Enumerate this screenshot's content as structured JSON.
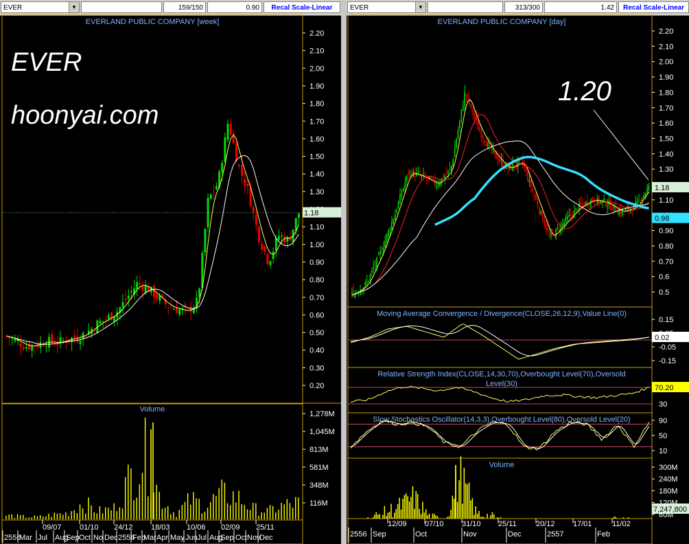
{
  "left": {
    "symbol": "EVER",
    "bar_count": "159/150",
    "last_price": "0.90",
    "recal_label": "Recal Scale-Linear",
    "title": "EVERLAND PUBLIC COMPANY [week]",
    "watermark_symbol": "EVER",
    "watermark_site": "hoonyai.com",
    "price_axis": [
      "2.20",
      "2.10",
      "2.00",
      "1.90",
      "1.80",
      "1.70",
      "1.60",
      "1.50",
      "1.40",
      "1.30",
      "1.20",
      "1.10",
      "1.00",
      "0.90",
      "0.80",
      "0.70",
      "0.60",
      "0.50",
      "0.40",
      "0.30",
      "0.20"
    ],
    "price_marker": "1.18",
    "volume_title": "Volume",
    "volume_axis": [
      "1,278M",
      "1,045M",
      "813M",
      "581M",
      "348M",
      "116M"
    ],
    "date_ticks": [
      "09/07",
      "01/10",
      "24/12",
      "18/03",
      "10/06",
      "02/09",
      "25/11"
    ],
    "month_ticks": [
      "2556",
      "Mar",
      "Jul",
      "Aug",
      "Sep",
      "Oct",
      "No",
      "Dec",
      "2556",
      "Feb",
      "Mar",
      "Apr",
      "May",
      "Jun",
      "Jul",
      "Aug",
      "Sep",
      "Oct",
      "Nov",
      "Dec"
    ]
  },
  "right": {
    "symbol": "EVER",
    "bar_count": "313/300",
    "last_price": "1.42",
    "recal_label": "Recal Scale-Linear",
    "title": "EVERLAND PUBLIC COMPANY [day]",
    "annotation": "1.20",
    "price_axis": [
      "2.20",
      "2.10",
      "2.00",
      "1.90",
      "1.80",
      "1.70",
      "1.60",
      "1.50",
      "1.40",
      "1.30",
      "1.20",
      "1.10",
      "1.00",
      "0.90",
      "0.80",
      "0.70",
      "0.6",
      "0.5"
    ],
    "price_marker_1": "1.18",
    "price_marker_2": "0.98",
    "macd_title": "Moving Average Convergence / Divergence(CLOSE,26,12,9),Value Line(0)",
    "macd_axis": [
      "0.15",
      "0.05",
      "-0.05",
      "-0.15"
    ],
    "macd_marker": "0.02",
    "rsi_title_1": "Relative Strength Index(CLOSE,14,30,70),Overbought Level(70),Oversold",
    "rsi_title_2": "Level(30)",
    "rsi_axis": [
      "70",
      "30"
    ],
    "rsi_marker": "70.20",
    "stoch_title": "Slow Stochastics Oscillator(14,3,3),Overbought Level(80),Oversold Level(20)",
    "stoch_axis": [
      "90",
      "50",
      "10"
    ],
    "volume_title": "Volume",
    "volume_axis": [
      "300M",
      "240M",
      "180M",
      "120M",
      "60M"
    ],
    "volume_marker": "7,247,800",
    "date_ticks": [
      "12/09",
      "07/10",
      "31/10",
      "25/11",
      "20/12",
      "17/01",
      "11/02"
    ],
    "month_ticks": [
      "2556",
      "Sep",
      "Oct",
      "Nov",
      "Dec",
      "2557",
      "Feb"
    ]
  },
  "colors": {
    "up": "#00dd00",
    "down": "#ee0000",
    "ma_fast": "#ffff66",
    "ma_slow": "#ffffff",
    "ma_red": "#ff2020",
    "ma_long": "#33e0ff",
    "grid": "#c8a000",
    "marker_bg": "#d8f0d8",
    "marker_cyan": "#33e0ff",
    "marker_yellow": "#ffff00"
  },
  "chart_data": [
    {
      "type": "bar",
      "title": "EVERLAND PUBLIC COMPANY [week]",
      "series": [
        {
          "name": "close",
          "values": [
            0.48,
            0.45,
            0.42,
            0.43,
            0.45,
            0.44,
            0.46,
            0.47,
            0.5,
            0.55,
            0.58,
            0.62,
            0.7,
            0.78,
            0.75,
            0.7,
            0.65,
            0.63,
            0.62,
            0.68,
            1.25,
            1.35,
            1.7,
            1.45,
            1.3,
            1.05,
            0.9,
            1.05,
            1.02,
            1.18
          ]
        }
      ],
      "ylim": [
        0.2,
        2.2
      ]
    },
    {
      "type": "bar",
      "title": "Volume",
      "series": [
        {
          "name": "volume",
          "values": [
            80,
            60,
            50,
            90,
            120,
            300,
            150,
            200,
            700,
            1150,
            400,
            100,
            350,
            250,
            450,
            400,
            200,
            150,
            250,
            300
          ]
        }
      ],
      "ylim": [
        0,
        1278
      ]
    },
    {
      "type": "line",
      "title": "EVERLAND PUBLIC COMPANY [day]",
      "series": [
        {
          "name": "close",
          "values": [
            0.48,
            0.55,
            0.75,
            1.0,
            1.28,
            1.25,
            1.2,
            1.3,
            1.8,
            1.55,
            1.4,
            1.3,
            1.35,
            1.1,
            0.85,
            0.95,
            1.05,
            1.1,
            1.08,
            1.02,
            1.05,
            1.18
          ]
        }
      ],
      "ylim": [
        0.5,
        2.2
      ]
    },
    {
      "type": "bar",
      "title": "Volume",
      "series": [
        {
          "name": "volume",
          "values": [
            20,
            40,
            80,
            120,
            180,
            60,
            40,
            310,
            80,
            60,
            30,
            20,
            30,
            20,
            30,
            25,
            20,
            60,
            30,
            10
          ]
        }
      ],
      "ylim": [
        0,
        300
      ]
    }
  ]
}
